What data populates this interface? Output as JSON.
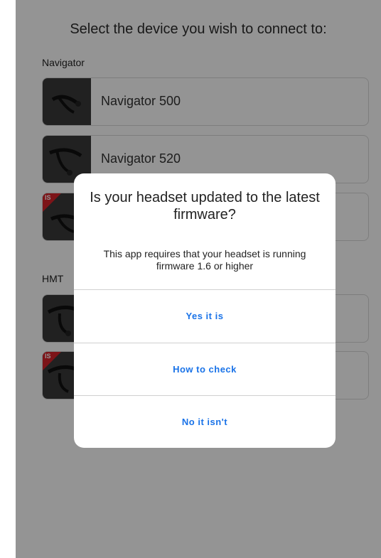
{
  "header": {
    "title": "Select the device you wish to connect to:"
  },
  "sections": [
    {
      "label": "Navigator",
      "devices": [
        {
          "name": "Navigator 500",
          "icon": "headset-icon",
          "badge": ""
        },
        {
          "name": "Navigator 520",
          "icon": "headset-icon",
          "badge": ""
        },
        {
          "name": "",
          "icon": "headset-icon",
          "badge": "IS"
        }
      ]
    },
    {
      "label": "HMT",
      "devices": [
        {
          "name": "",
          "icon": "headset-icon",
          "badge": ""
        },
        {
          "name": "",
          "icon": "headset-icon",
          "badge": "IS"
        }
      ]
    }
  ],
  "dialog": {
    "title": "Is your headset updated to the latest firmware?",
    "message": "This app requires that your headset is running firmware 1.6 or higher",
    "buttons": {
      "yes": "Yes it is",
      "how": "How to check",
      "no": "No it isn't"
    }
  },
  "colors": {
    "accent": "#1a73e8",
    "badge": "#d8232a",
    "overlay": "rgba(0,0,0,0.42)"
  }
}
